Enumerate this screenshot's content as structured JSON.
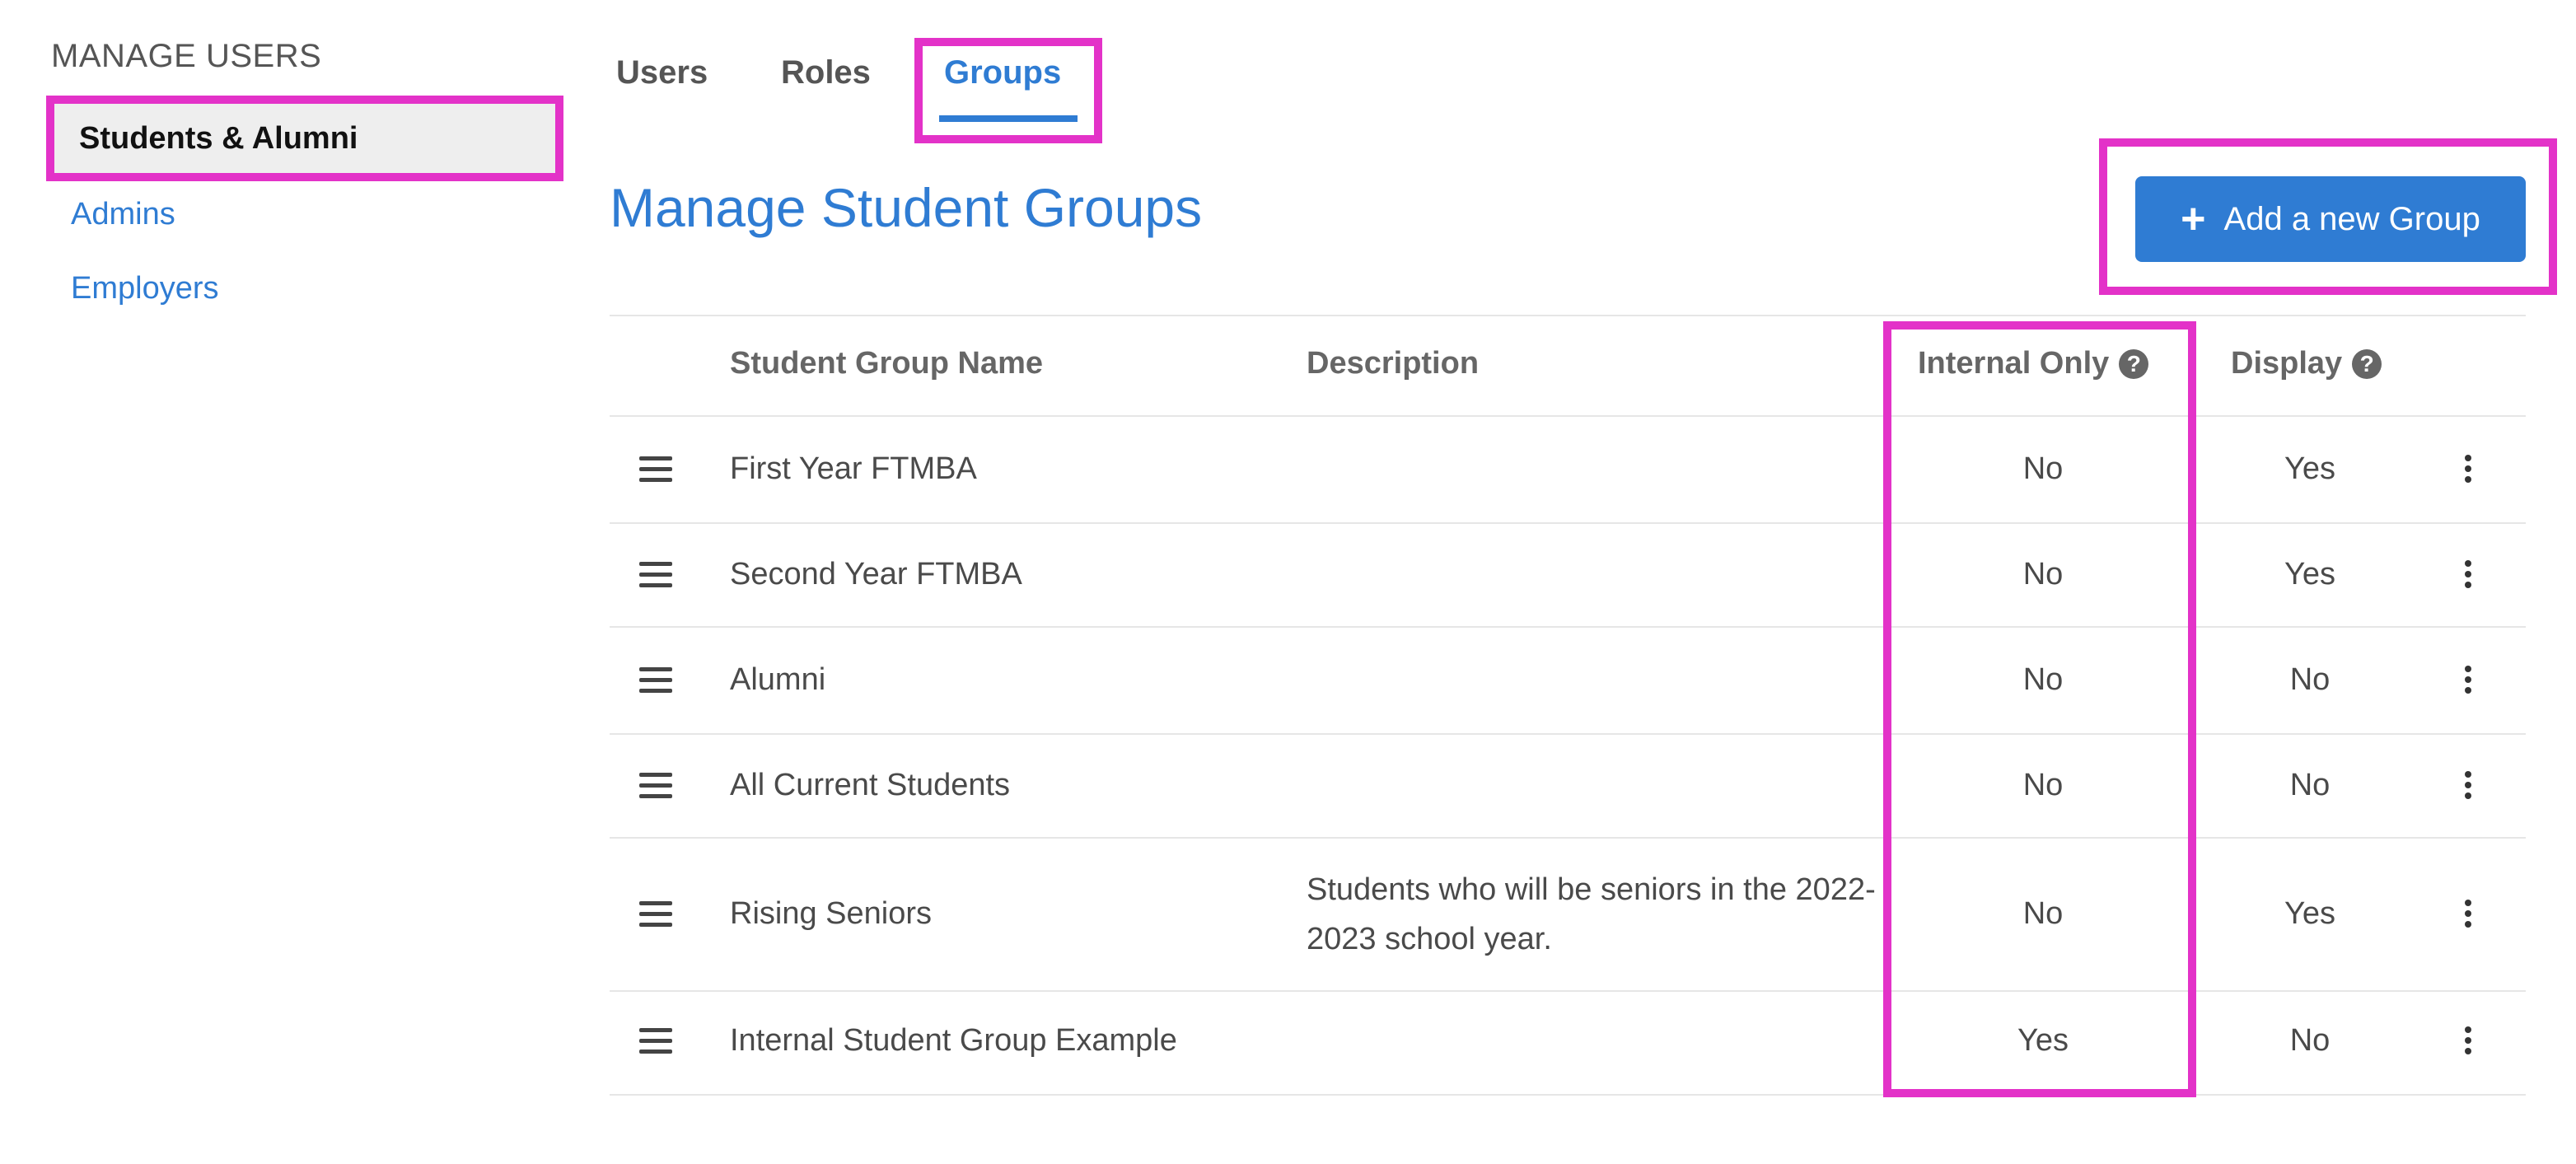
{
  "sidebar": {
    "heading": "MANAGE USERS",
    "items": [
      {
        "label": "Students & Alumni",
        "active": true
      },
      {
        "label": "Admins",
        "active": false
      },
      {
        "label": "Employers",
        "active": false
      }
    ]
  },
  "tabs": [
    {
      "label": "Users",
      "active": false
    },
    {
      "label": "Roles",
      "active": false
    },
    {
      "label": "Groups",
      "active": true
    }
  ],
  "page": {
    "title": "Manage Student Groups",
    "add_button_label": "Add a new Group"
  },
  "table": {
    "columns": {
      "name": "Student Group Name",
      "description": "Description",
      "internal_only": "Internal Only",
      "display": "Display"
    },
    "rows": [
      {
        "name": "First Year FTMBA",
        "description": "",
        "internal_only": "No",
        "display": "Yes"
      },
      {
        "name": "Second Year FTMBA",
        "description": "",
        "internal_only": "No",
        "display": "Yes"
      },
      {
        "name": "Alumni",
        "description": "",
        "internal_only": "No",
        "display": "No"
      },
      {
        "name": "All Current Students",
        "description": "",
        "internal_only": "No",
        "display": "No"
      },
      {
        "name": "Rising Seniors",
        "description": "Students who will be seniors in the 2022-2023 school year.",
        "internal_only": "No",
        "display": "Yes"
      },
      {
        "name": "Internal Student Group Example",
        "description": "",
        "internal_only": "Yes",
        "display": "No"
      }
    ]
  },
  "colors": {
    "accent": "#2f7cd3",
    "highlight": "#e332c8"
  }
}
